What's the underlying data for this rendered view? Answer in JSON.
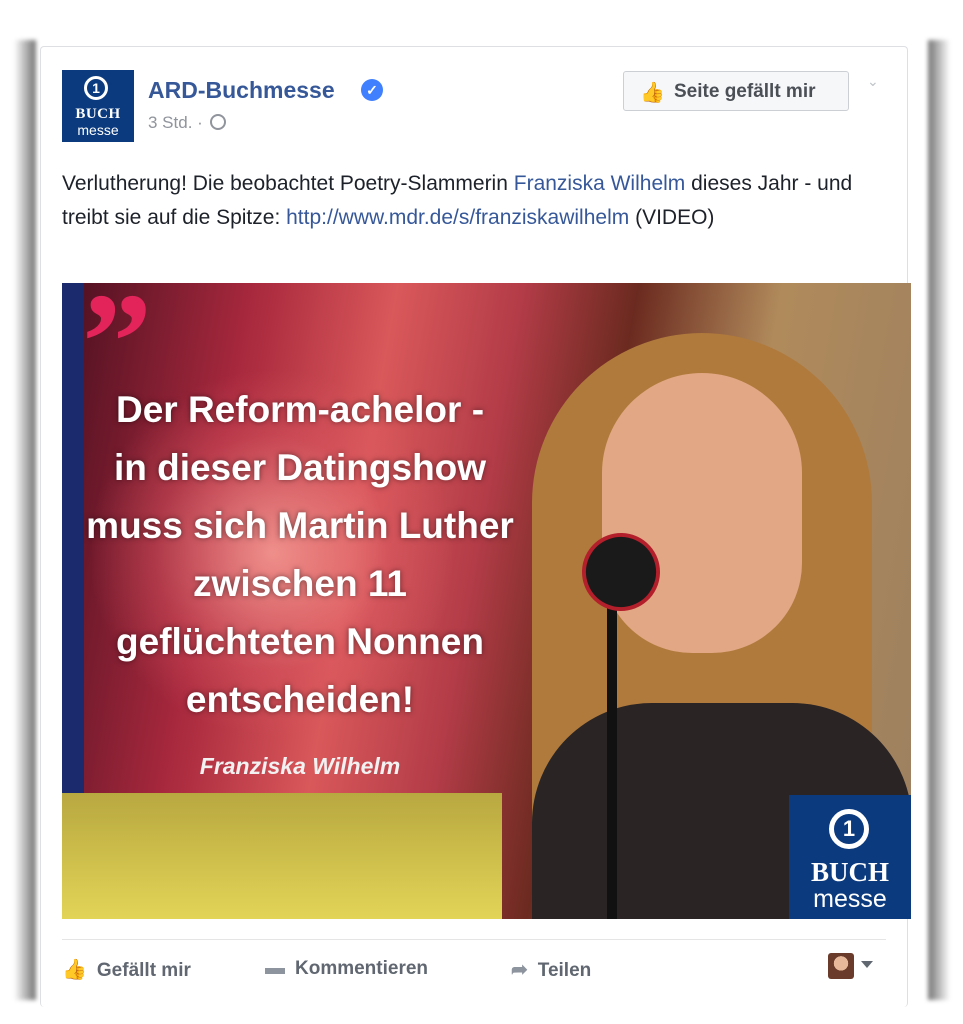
{
  "post": {
    "page_name": "ARD-Buchmesse",
    "time": "3 Std. ·",
    "like_page_button": "Seite gefällt mir",
    "avatar_line1": "BUCH",
    "avatar_line2": "messe",
    "avatar_symbol": "1",
    "text_part1": "Verlutherung! Die beobachtet Poetry-Slammerin ",
    "text_link_name": "Franziska Wilhelm",
    "text_part2": " dieses Jahr - und treibt sie auf die Spitze: ",
    "text_link_url": "http://www.mdr.de/s/franziskawilhelm",
    "text_part3": " (VIDEO)"
  },
  "media": {
    "quote_mark": "”",
    "quote_line1": "Der Reform-achelor -",
    "quote_line2": "in dieser Datingshow",
    "quote_line3": "muss sich Martin Luther",
    "quote_line4": "zwischen 11",
    "quote_line5": "geflüchteten Nonnen",
    "quote_line6": "entscheiden!",
    "author": "Franziska Wilhelm",
    "logo_symbol": "1",
    "logo_line1": "BUCH",
    "logo_line2": "messe"
  },
  "actions": {
    "like": "Gefällt mir",
    "comment": "Kommentieren",
    "share": "Teilen"
  },
  "icons": {
    "verified": "verified-check-icon",
    "globe": "globe-icon",
    "thumb": "thumb-up-icon",
    "comment": "comment-icon",
    "share": "share-arrow-icon",
    "chevron": "chevron-down-icon"
  },
  "colors": {
    "link": "#365899",
    "brand_blue": "#0b3a7e",
    "quote_pink": "#e3245b",
    "verified": "#4080ff"
  }
}
